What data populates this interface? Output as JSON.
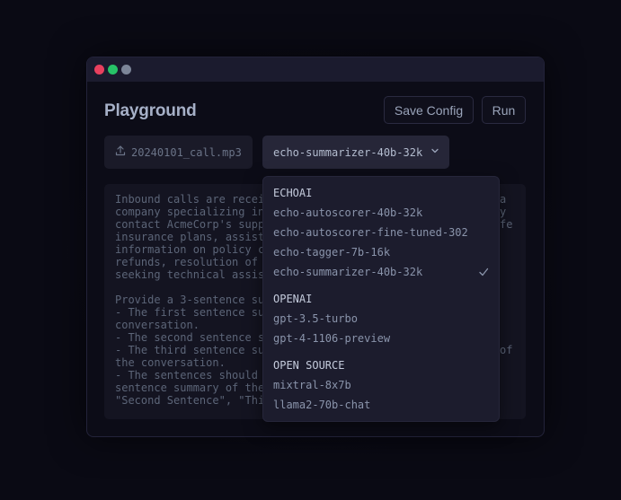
{
  "window": {
    "title": "Playground",
    "buttons": {
      "save_config": "Save Config",
      "run": "Run"
    }
  },
  "file": {
    "name": "20240101_call.mp3",
    "icon": "upload-icon"
  },
  "model_select": {
    "selected": "echo-summarizer-40b-32k",
    "icon": "chevron-down-icon"
  },
  "prompt": {
    "lines": [
      "Inbound calls are recei",
      "company specializing in",
      "contact AcmeCorp's supp",
      "insurance plans, assist",
      "information on policy c",
      "refunds, resolution of",
      "seeking technical assis",
      "",
      "Provide a 3-sentence su",
      "- The first sentence su",
      "conversation.",
      "- The second sentence s",
      "- The third sentence su",
      "the conversation.",
      "- The sentences should",
      "sentence summary of the",
      "\"Second Sentence\", \"Thi"
    ],
    "right_fragments": [
      {
        "line": 0,
        "text": "a"
      },
      {
        "line": 1,
        "text": "y"
      },
      {
        "line": 2,
        "text": "fe"
      },
      {
        "line": 12,
        "text": "of"
      }
    ]
  },
  "dropdown": {
    "groups": [
      {
        "label": "ECHOAI",
        "options": [
          {
            "label": "echo-autoscorer-40b-32k",
            "selected": false
          },
          {
            "label": "echo-autoscorer-fine-tuned-302",
            "selected": false
          },
          {
            "label": "echo-tagger-7b-16k",
            "selected": false
          },
          {
            "label": "echo-summarizer-40b-32k",
            "selected": true
          }
        ]
      },
      {
        "label": "OPENAI",
        "options": [
          {
            "label": "gpt-3.5-turbo",
            "selected": false
          },
          {
            "label": "gpt-4-1106-preview",
            "selected": false
          }
        ]
      },
      {
        "label": "OPEN SOURCE",
        "options": [
          {
            "label": "mixtral-8x7b",
            "selected": false
          },
          {
            "label": "llama2-70b-chat",
            "selected": false
          }
        ]
      }
    ]
  },
  "colors": {
    "background": "#0a0a14",
    "titlebar": "#1b1b2e",
    "close_dot": "#e8405e",
    "maximize_dot": "#27c267",
    "minimize_dot": "#7c8598"
  }
}
